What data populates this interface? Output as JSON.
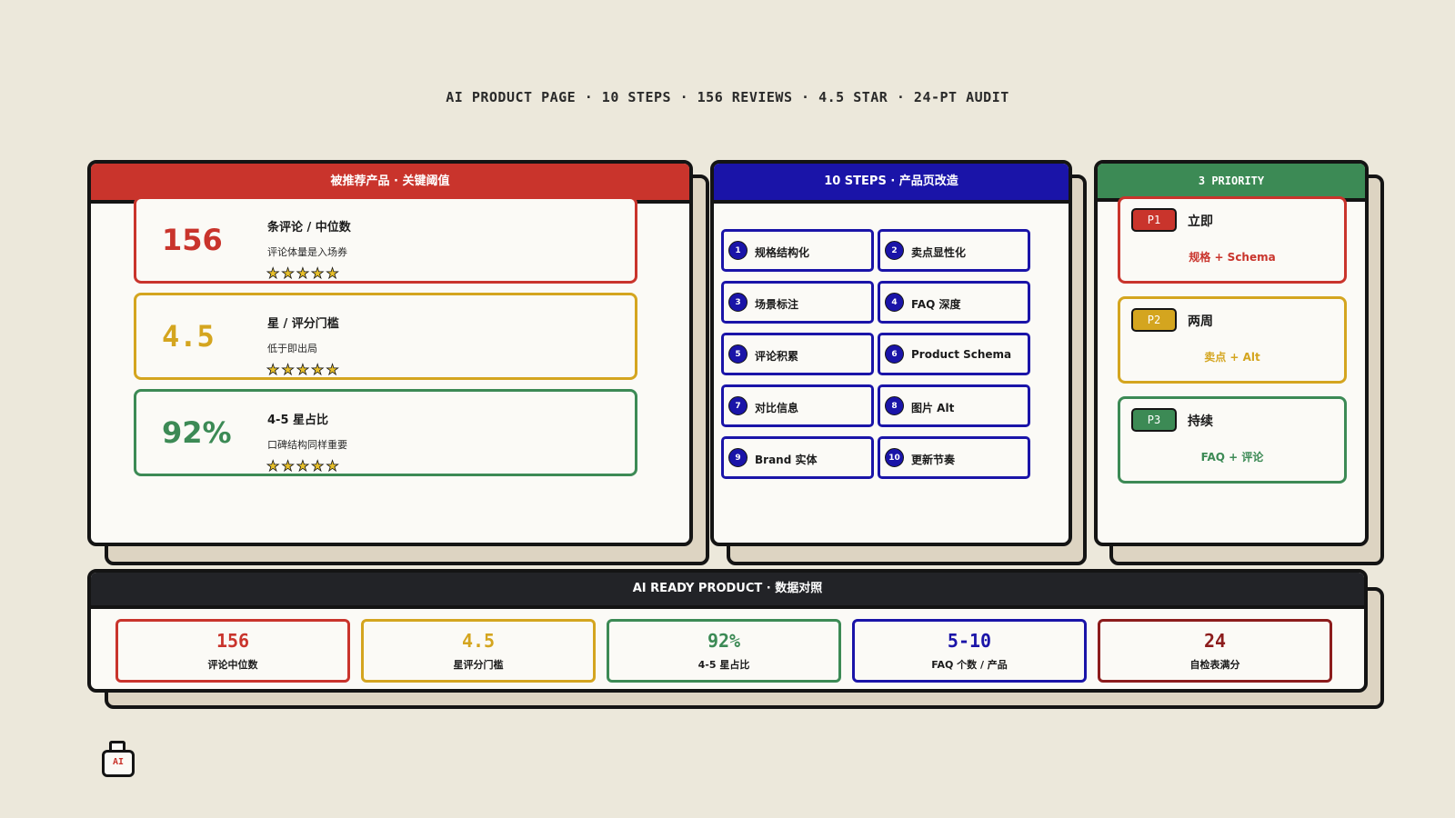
{
  "top_banner": "AI PRODUCT PAGE · 10 STEPS · 156 REVIEWS · 4.5 STAR · 24-PT AUDIT",
  "left_panel": {
    "header": "被推荐产品 · 关键阈值",
    "cards": [
      {
        "value": "156",
        "label": "条评论 / 中位数",
        "sub": "评论体量是入场券",
        "stars": "★★★★★"
      },
      {
        "value": "4.5",
        "label": "星 / 评分门槛",
        "sub": "低于即出局",
        "stars": "★★★★★"
      },
      {
        "value": "92%",
        "label": "4-5 星占比",
        "sub": "口碑结构同样重要",
        "stars": "★★★★★"
      }
    ]
  },
  "steps_panel": {
    "header": "10 STEPS · 产品页改造",
    "steps": [
      {
        "num": "1",
        "label": "规格结构化"
      },
      {
        "num": "2",
        "label": "卖点显性化"
      },
      {
        "num": "3",
        "label": "场景标注"
      },
      {
        "num": "4",
        "label": "FAQ 深度"
      },
      {
        "num": "5",
        "label": "评论积累"
      },
      {
        "num": "6",
        "label": "Product Schema"
      },
      {
        "num": "7",
        "label": "对比信息"
      },
      {
        "num": "8",
        "label": "图片 Alt"
      },
      {
        "num": "9",
        "label": "Brand 实体"
      },
      {
        "num": "10",
        "label": "更新节奏"
      }
    ]
  },
  "priority_panel": {
    "header": "3 PRIORITY",
    "items": [
      {
        "badge": "P1",
        "title": "立即",
        "desc": "规格 + Schema"
      },
      {
        "badge": "P2",
        "title": "两周",
        "desc": "卖点 + Alt"
      },
      {
        "badge": "P3",
        "title": "持续",
        "desc": "FAQ + 评论"
      }
    ]
  },
  "bottom_panel": {
    "header": "AI READY PRODUCT · 数据对照",
    "metrics": [
      {
        "value": "156",
        "label": "评论中位数"
      },
      {
        "value": "4.5",
        "label": "星评分门槛"
      },
      {
        "value": "92%",
        "label": "4-5 星占比"
      },
      {
        "value": "5-10",
        "label": "FAQ 个数 / 产品"
      },
      {
        "value": "24",
        "label": "自检表满分"
      }
    ]
  },
  "logo": {
    "text": "AI",
    "icon": "ai-bottle-icon"
  },
  "colors": {
    "red": "#c9342c",
    "yellow": "#d4a51f",
    "green": "#3c8a55",
    "blue": "#1a14a8",
    "maroon": "#8c1c1c",
    "dark": "#222327",
    "background": "#ece8db"
  }
}
